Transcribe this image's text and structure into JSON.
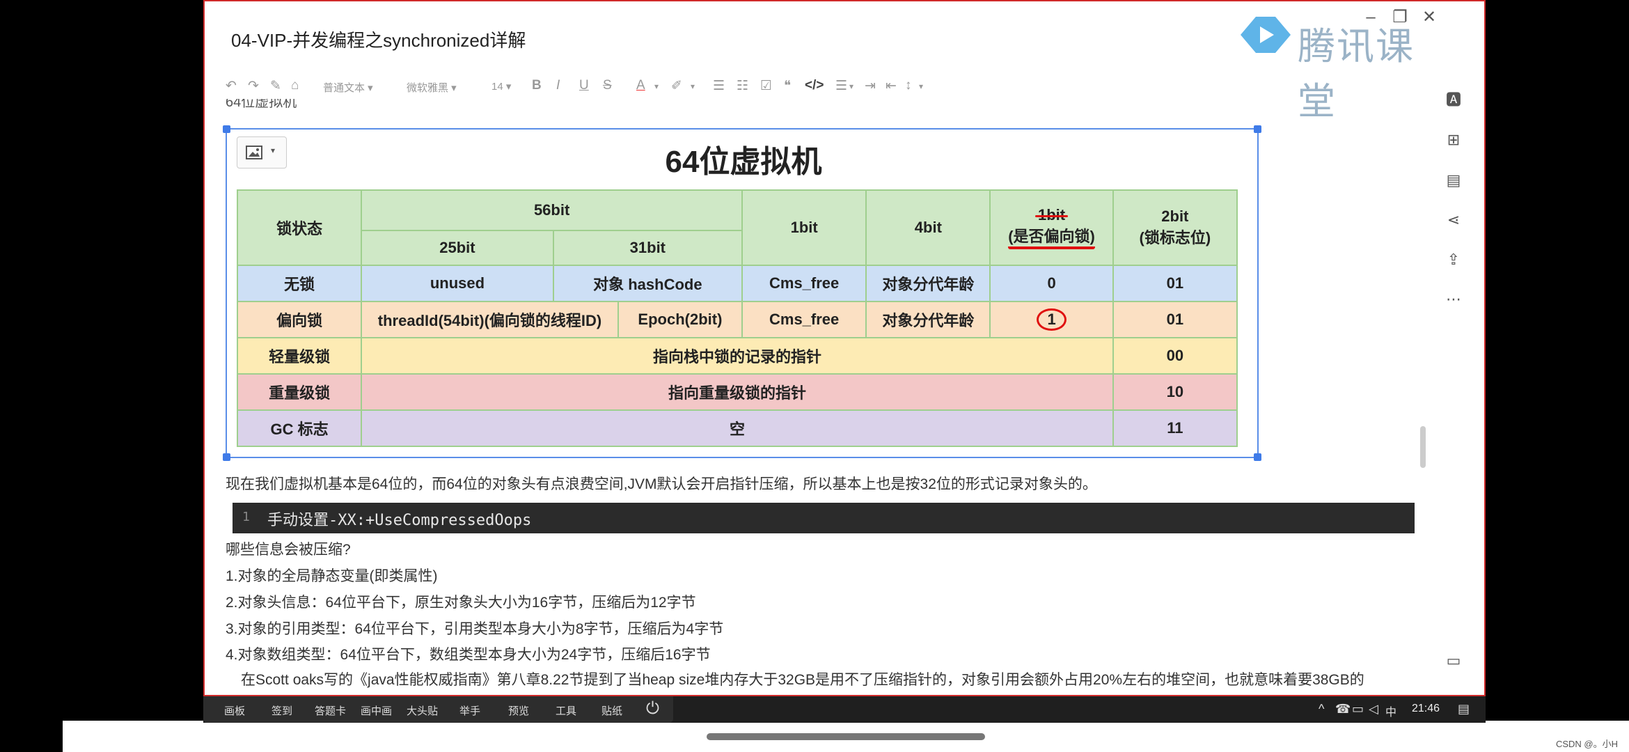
{
  "window": {
    "title": "04-VIP-并发编程之synchronized详解",
    "logo_text": "腾讯课堂"
  },
  "toolbar": {
    "paragraph_style": "普通文本",
    "font_name": "微软雅黑",
    "font_size": "14",
    "bold": "B",
    "italic": "I",
    "underline": "U",
    "strike": "S",
    "font_color": "A"
  },
  "cut_heading": "64位虚拟机",
  "image": {
    "title": "64位虚拟机",
    "header": {
      "lock_state": "锁状态",
      "bits56": "56bit",
      "bits25": "25bit",
      "bits31": "31bit",
      "bits1": "1bit",
      "bits4": "4bit",
      "biased_bit": "1bit",
      "biased_label": "(是否偏向锁)",
      "flag_bit": "2bit",
      "flag_label": "(锁标志位)"
    },
    "rows": {
      "unlocked": {
        "state": "无锁",
        "c25": "unused",
        "c31": "对象 hashCode",
        "c1": "Cms_free",
        "c4": "对象分代年龄",
        "biased": "0",
        "flag": "01"
      },
      "biased": {
        "state": "偏向锁",
        "thread": "threadId(54bit)(偏向锁的线程ID)",
        "epoch": "Epoch(2bit)",
        "c1": "Cms_free",
        "c4": "对象分代年龄",
        "biased": "1",
        "flag": "01"
      },
      "light": {
        "state": "轻量级锁",
        "content": "指向栈中锁的记录的指针",
        "flag": "00"
      },
      "heavy": {
        "state": "重量级锁",
        "content": "指向重量级锁的指针",
        "flag": "10"
      },
      "gc": {
        "state": "GC 标志",
        "content": "空",
        "flag": "11"
      }
    }
  },
  "content": {
    "intro": "现在我们虚拟机基本是64位的，而64位的对象头有点浪费空间,JVM默认会开启指针压缩，所以基本上也是按32位的形式记录对象头的。",
    "code_line_no": "1",
    "code": "手动设置-XX:+UseCompressedOops",
    "question": "哪些信息会被压缩?",
    "item1": "1.对象的全局静态变量(即类属性)",
    "item2": "2.对象头信息：64位平台下，原生对象头大小为16字节，压缩后为12字节",
    "item3": "3.对象的引用类型：64位平台下，引用类型本身大小为8字节，压缩后为4字节",
    "item4": "4.对象数组类型：64位平台下，数组类型本身大小为24字节，压缩后16字节",
    "item5": "在Scott oaks写的《java性能权威指南》第八章8.22节提到了当heap size堆内存大于32GB是用不了压缩指针的，对象引用会额外占用20%左右的堆空间，也就意味着要38GB的"
  },
  "taskbar": {
    "buttons": [
      "画板",
      "签到",
      "答题卡",
      "画中画",
      "大头贴",
      "举手",
      "预览",
      "工具",
      "贴纸"
    ],
    "ime": "中",
    "time": "21:46"
  },
  "watermark": "CSDN @。小H"
}
